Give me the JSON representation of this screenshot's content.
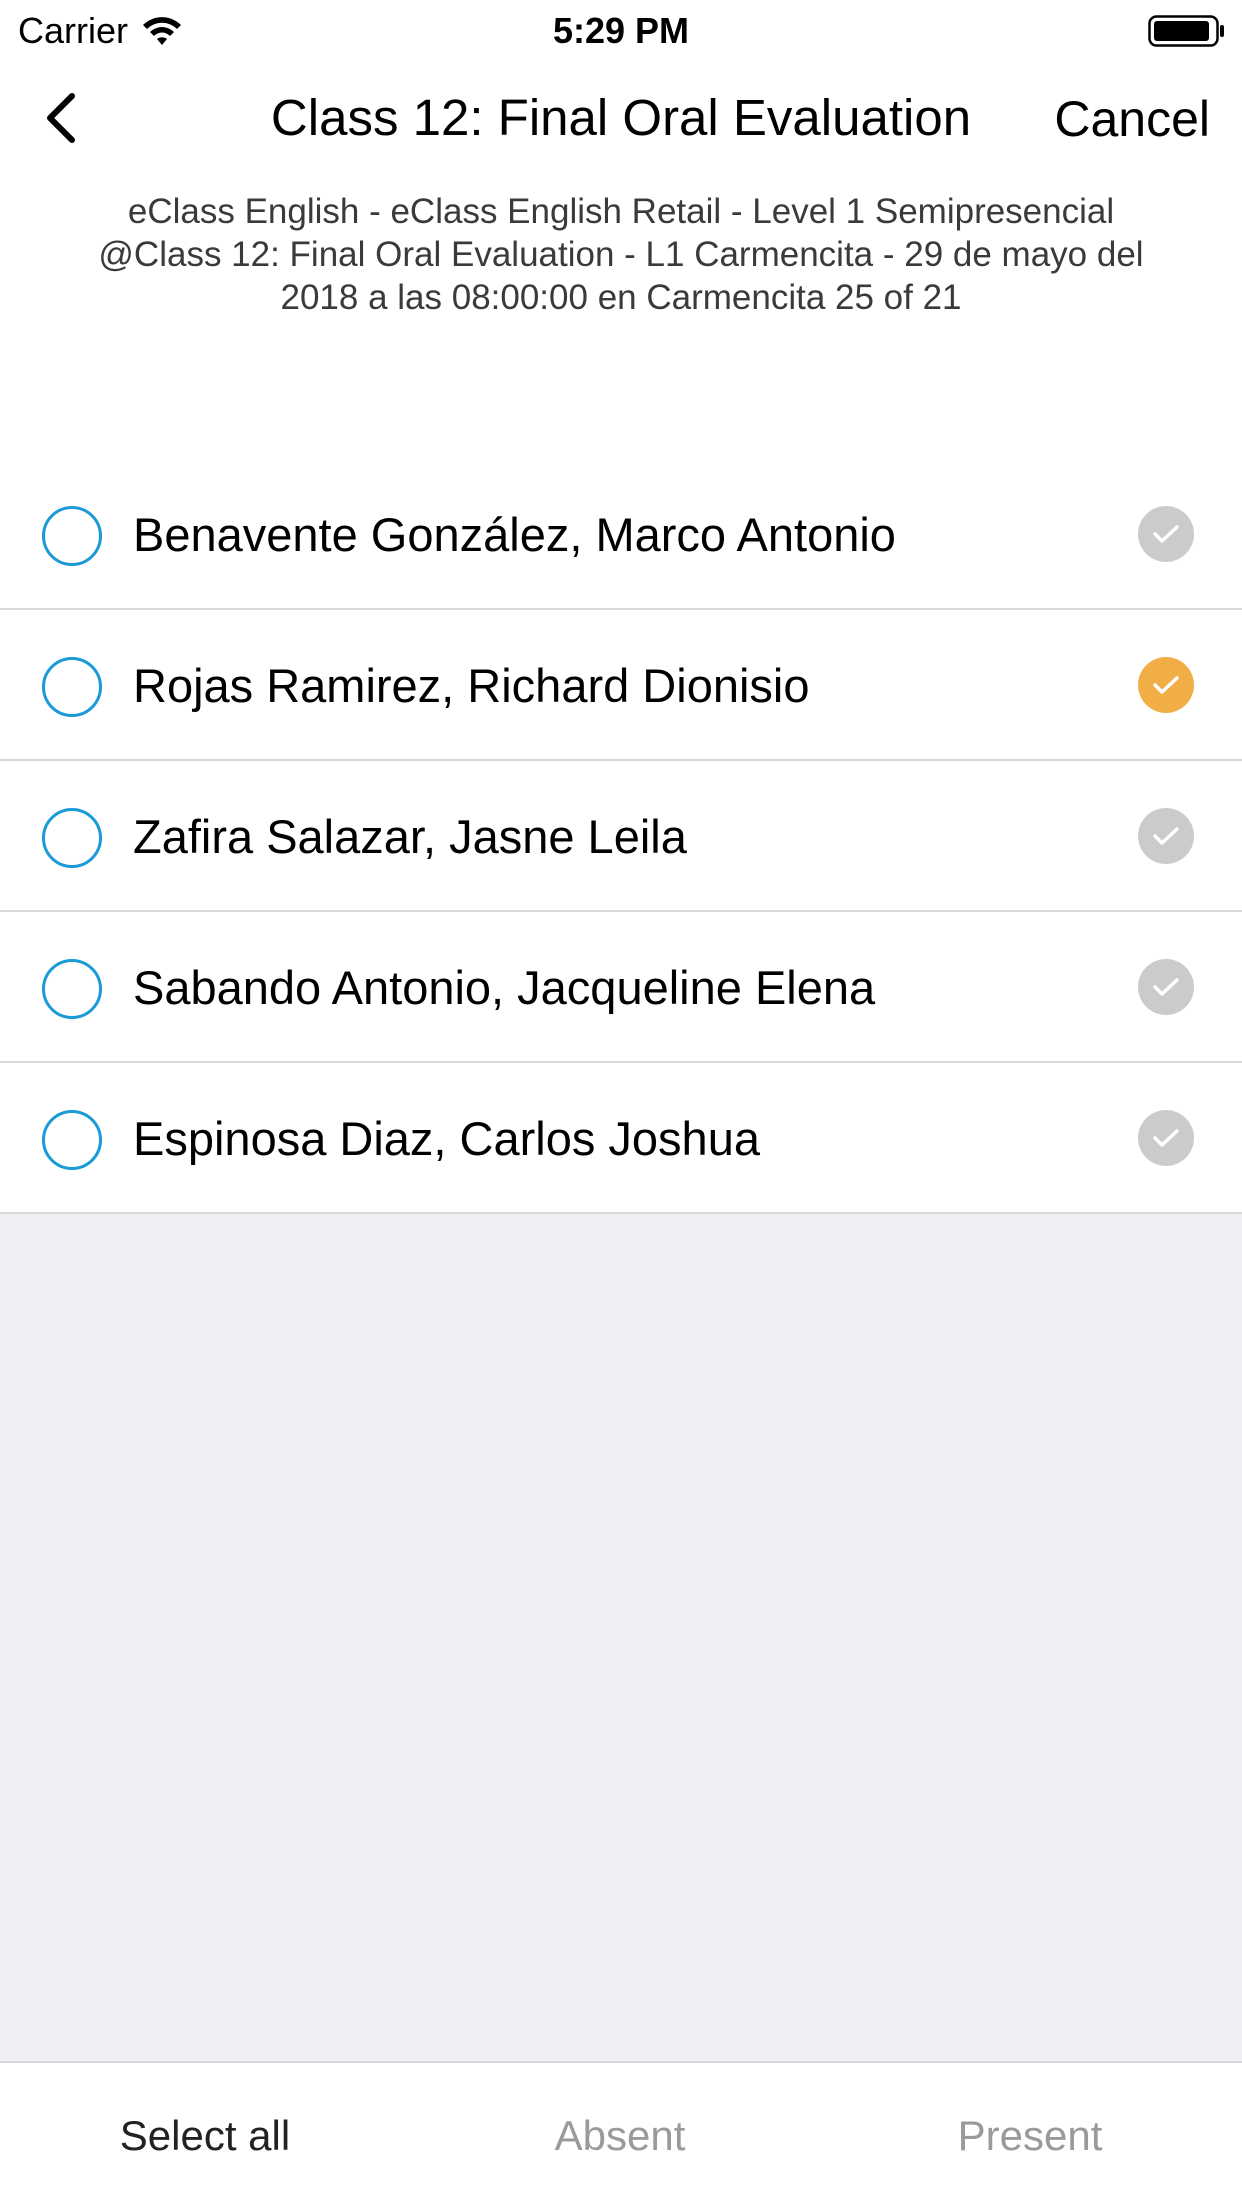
{
  "status_bar": {
    "carrier": "Carrier",
    "time": "5:29 PM"
  },
  "nav": {
    "title": "Class 12: Final Oral Evaluation",
    "cancel_label": "Cancel"
  },
  "subtitle": {
    "line1": "eClass English - eClass English Retail -  Level 1 Semipresencial",
    "line2": "@Class 12: Final Oral Evaluation - L1 Carmencita - 29 de mayo del",
    "line3": "2018 a las 08:00:00 en Carmencita 25 of 21"
  },
  "students": [
    {
      "name": "Benavente González, Marco Antonio",
      "status": "gray"
    },
    {
      "name": "Rojas Ramirez, Richard Dionisio",
      "status": "orange"
    },
    {
      "name": "Zafira Salazar, Jasne Leila",
      "status": "gray"
    },
    {
      "name": "Sabando Antonio, Jacqueline Elena",
      "status": "gray"
    },
    {
      "name": "Espinosa Diaz, Carlos Joshua",
      "status": "gray"
    }
  ],
  "toolbar": {
    "select_all": "Select all",
    "absent": "Absent",
    "present": "Present"
  },
  "colors": {
    "accent_blue": "#1a9ad6",
    "check_gray": "#cbcbcd",
    "check_orange": "#f1ae47",
    "background": "#efeff4"
  },
  "icons": [
    "wifi-icon",
    "battery-icon",
    "back-chevron-icon",
    "checkmark-icon"
  ]
}
